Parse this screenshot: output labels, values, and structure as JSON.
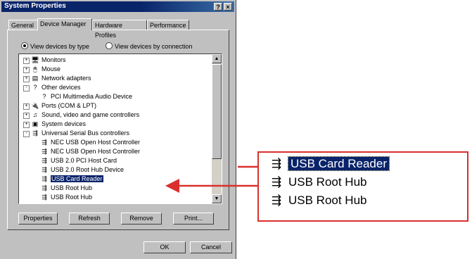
{
  "window": {
    "title": "System Properties",
    "help_btn": "?",
    "close_btn": "×",
    "tabs": [
      "General",
      "Device Manager",
      "Hardware Profiles",
      "Performance"
    ]
  },
  "view": {
    "by_type": "View devices by type",
    "by_connection": "View devices by connection"
  },
  "tree": [
    {
      "label": "Monitors",
      "exp": "+",
      "icon": "🖥"
    },
    {
      "label": "Mouse",
      "exp": "+",
      "icon": "🖱"
    },
    {
      "label": "Network adapters",
      "exp": "+",
      "icon": "▤"
    },
    {
      "label": "Other devices",
      "exp": "-",
      "icon": "?"
    },
    {
      "label": "PCI Multimedia Audio Device",
      "icon": "?"
    },
    {
      "label": "Ports (COM & LPT)",
      "exp": "+",
      "icon": "🔌"
    },
    {
      "label": "Sound, video and game controllers",
      "exp": "+",
      "icon": "♫"
    },
    {
      "label": "System devices",
      "exp": "+",
      "icon": "▣"
    },
    {
      "label": "Universal Serial Bus controllers",
      "exp": "-",
      "icon": "⇶"
    },
    {
      "label": "NEC USB Open Host Controller",
      "icon": "⇶"
    },
    {
      "label": "NEC USB Open Host Controller",
      "icon": "⇶"
    },
    {
      "label": "USB 2.0 PCI Host Card",
      "icon": "⇶"
    },
    {
      "label": "USB 2.0 Root Hub Device",
      "icon": "⇶"
    },
    {
      "label": "USB Card Reader",
      "icon": "⇶"
    },
    {
      "label": "USB Root Hub",
      "icon": "⇶"
    },
    {
      "label": "USB Root Hub",
      "icon": "⇶"
    }
  ],
  "buttons": {
    "properties": "Properties",
    "refresh": "Refresh",
    "remove": "Remove",
    "print": "Print...",
    "ok": "OK",
    "cancel": "Cancel"
  },
  "scroll": {
    "up": "▲",
    "down": "▼"
  },
  "zoom": {
    "items": [
      "USB Card Reader",
      "USB Root Hub",
      "USB Root Hub"
    ]
  },
  "colors": {
    "callout": "#d9302c",
    "selection": "#0a246a"
  }
}
